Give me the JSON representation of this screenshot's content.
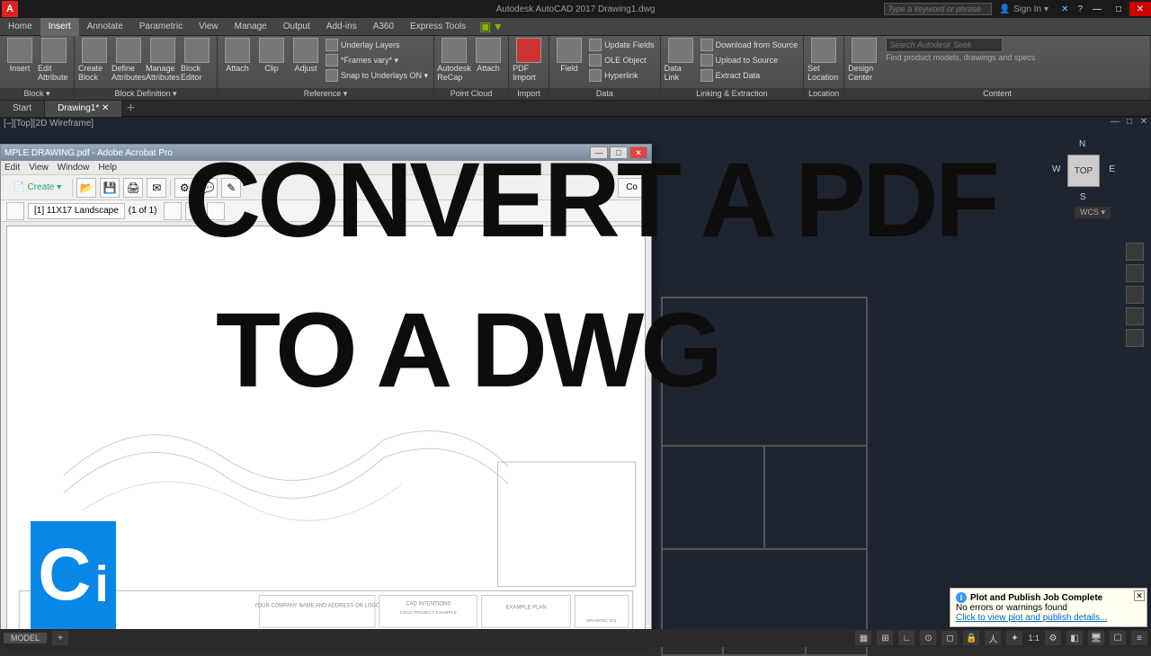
{
  "app": {
    "title": "Autodesk AutoCAD 2017   Drawing1.dwg",
    "search_placeholder": "Type a keyword or phrase",
    "signin": "Sign In"
  },
  "tabs": [
    "Home",
    "Insert",
    "Annotate",
    "Parametric",
    "View",
    "Manage",
    "Output",
    "Add-ins",
    "A360",
    "Express Tools"
  ],
  "active_tab": "Insert",
  "ribbon": {
    "block": {
      "label": "Block ▾",
      "items": [
        "Insert",
        "Edit Attribute"
      ]
    },
    "blockdef": {
      "label": "Block Definition ▾",
      "items": [
        "Create Block",
        "Define Attributes",
        "Manage Attributes",
        "Block Editor"
      ]
    },
    "reference": {
      "label": "Reference ▾",
      "items": [
        "Attach",
        "Clip",
        "Adjust"
      ],
      "opts": [
        "Underlay Layers",
        "*Frames vary* ▾",
        "Snap to Underlays ON ▾"
      ]
    },
    "pointcloud": {
      "label": "Point Cloud",
      "items": [
        "Autodesk ReCap",
        "Attach"
      ]
    },
    "import": {
      "label": "Import",
      "items": [
        "PDF Import"
      ]
    },
    "data": {
      "label": "Data",
      "items": [
        "Field"
      ],
      "opts": [
        "Update Fields",
        "OLE Object",
        "Hyperlink"
      ]
    },
    "linking": {
      "label": "Linking & Extraction",
      "items": [
        "Data Link"
      ],
      "opts": [
        "Download from Source",
        "Upload to Source",
        "Extract Data"
      ]
    },
    "location": {
      "label": "Location",
      "items": [
        "Set Location"
      ]
    },
    "content": {
      "label": "Content",
      "items": [
        "Design Center"
      ],
      "search": "Search Autodesk Seek",
      "hint": "Find product models, drawings and specs"
    }
  },
  "doctabs": {
    "start": "Start",
    "drawing": "Drawing1*"
  },
  "viewport": {
    "label": "[–][Top][2D Wireframe]",
    "cube": "TOP",
    "n": "N",
    "s": "S",
    "e": "E",
    "w": "W",
    "wcs": "WCS ▾"
  },
  "acrobat": {
    "title": "MPLE DRAWING.pdf - Adobe Acrobat Pro",
    "menus": [
      "Edit",
      "View",
      "Window",
      "Help"
    ],
    "create": "Create ▾",
    "pagebox": "[1] 11X17 Landscape",
    "pagecount": "(1 of 1)",
    "panel": "Co"
  },
  "drawing_labels": {
    "plan": "EXAMPLE PLAN",
    "num": "DRAWING 101",
    "company": "YOUR COMPANY NAME AND\nADDRESS\nOR LOGO",
    "cad": "CAD INTENTIONS",
    "proj": "CSCO PROJECT EXAMPLE",
    "ample": "AMPLE"
  },
  "overlay": {
    "line1": "CONVERT A PDF",
    "line2": "TO A DWG"
  },
  "logo": {
    "c": "C",
    "i": "i"
  },
  "notification": {
    "title": "Plot and Publish Job Complete",
    "body": "No errors or warnings found",
    "link": "Click to view plot and publish details..."
  },
  "status": {
    "model": "MODEL",
    "scale": "1:1"
  }
}
